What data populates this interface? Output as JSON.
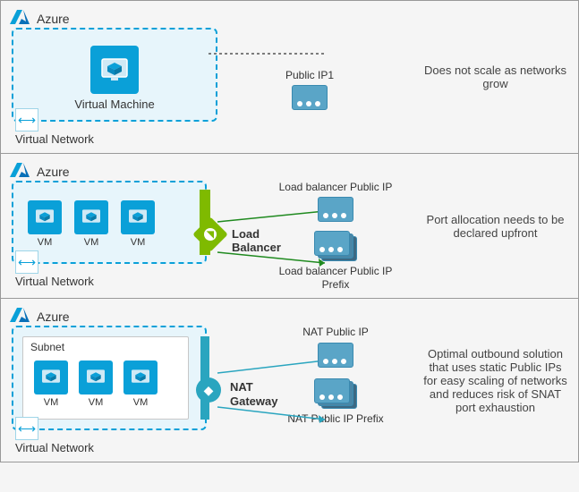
{
  "rows": [
    {
      "azure": "Azure",
      "vm_label": "Virtual Machine",
      "vnet_label": "Virtual Network",
      "ip_label": "Public IP1",
      "desc": "Does not scale as networks grow"
    },
    {
      "azure": "Azure",
      "vm_label": "VM",
      "vnet_label": "Virtual Network",
      "gateway_label": "Load Balancer",
      "ip1_label": "Load balancer Public IP",
      "ip2_label": "Load balancer Public IP Prefix",
      "desc": "Port allocation needs to be declared upfront"
    },
    {
      "azure": "Azure",
      "subnet_label": "Subnet",
      "vm_label": "VM",
      "vnet_label": "Virtual Network",
      "gateway_label": "NAT Gateway",
      "ip1_label": "NAT Public IP",
      "ip2_label": "NAT Public IP Prefix",
      "desc": "Optimal outbound solution that uses static Public IPs for easy scaling of networks and reduces risk of SNAT port exhaustion"
    }
  ]
}
